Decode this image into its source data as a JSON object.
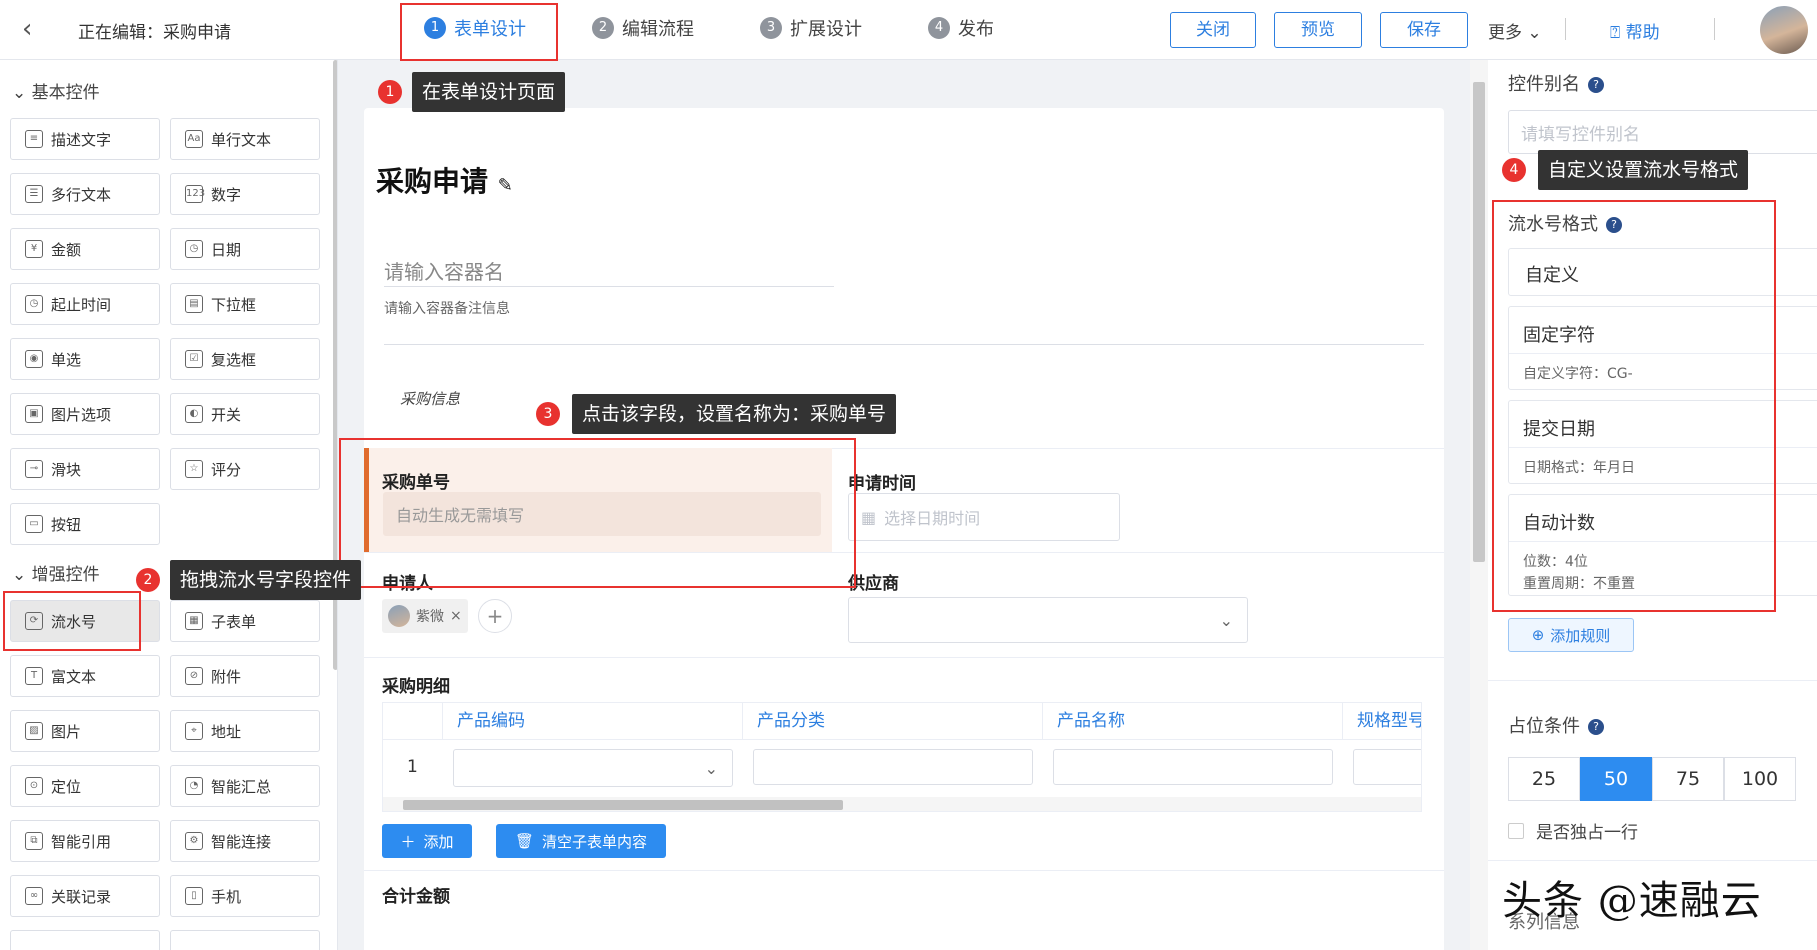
{
  "topbar": {
    "editing_label": "正在编辑：采购申请",
    "steps": [
      {
        "num": "1",
        "label": "表单设计"
      },
      {
        "num": "2",
        "label": "编辑流程"
      },
      {
        "num": "3",
        "label": "扩展设计"
      },
      {
        "num": "4",
        "label": "发布"
      }
    ],
    "close": "关闭",
    "preview": "预览",
    "save": "保存",
    "more": "更多",
    "help": "帮助"
  },
  "sidebar": {
    "basic_title": "基本控件",
    "basic": [
      {
        "label": "描述文字",
        "icon": "≡"
      },
      {
        "label": "单行文本",
        "icon": "Aa"
      },
      {
        "label": "多行文本",
        "icon": "☰"
      },
      {
        "label": "数字",
        "icon": "123"
      },
      {
        "label": "金额",
        "icon": "¥"
      },
      {
        "label": "日期",
        "icon": "◷"
      },
      {
        "label": "起止时间",
        "icon": "◷"
      },
      {
        "label": "下拉框",
        "icon": "▤"
      },
      {
        "label": "单选",
        "icon": "◉"
      },
      {
        "label": "复选框",
        "icon": "☑"
      },
      {
        "label": "图片选项",
        "icon": "▣"
      },
      {
        "label": "开关",
        "icon": "◐"
      },
      {
        "label": "滑块",
        "icon": "⊸"
      },
      {
        "label": "评分",
        "icon": "☆"
      },
      {
        "label": "按钮",
        "icon": "▭"
      }
    ],
    "enhanced_title": "增强控件",
    "enhanced": [
      {
        "label": "流水号",
        "icon": "⟳"
      },
      {
        "label": "子表单",
        "icon": "▦"
      },
      {
        "label": "富文本",
        "icon": "T"
      },
      {
        "label": "附件",
        "icon": "⊘"
      },
      {
        "label": "图片",
        "icon": "▨"
      },
      {
        "label": "地址",
        "icon": "⌖"
      },
      {
        "label": "定位",
        "icon": "⊙"
      },
      {
        "label": "智能汇总",
        "icon": "◔"
      },
      {
        "label": "智能引用",
        "icon": "⧉"
      },
      {
        "label": "智能连接",
        "icon": "⚙"
      },
      {
        "label": "关联记录",
        "icon": "∞"
      },
      {
        "label": "手机",
        "icon": "▯"
      }
    ]
  },
  "canvas": {
    "form_title": "采购申请",
    "container_name_placeholder": "请输入容器名",
    "container_remark_placeholder": "请输入容器备注信息",
    "section_label": "采购信息",
    "field_order_no": "采购单号",
    "field_order_no_placeholder": "自动生成无需填写",
    "field_apply_time": "申请时间",
    "field_apply_time_placeholder": "选择日期时间",
    "field_applicant": "申请人",
    "applicant_tag": "紫微",
    "field_supplier": "供应商",
    "detail_title": "采购明细",
    "table_headers": [
      "产品编码",
      "产品分类",
      "产品名称",
      "规格型号"
    ],
    "row_index": "1",
    "add_btn": "添加",
    "clear_btn": "清空子表单内容",
    "next_section": "合计金额"
  },
  "callouts": {
    "c1": {
      "num": "1",
      "text": "在表单设计页面"
    },
    "c2": {
      "num": "2",
      "text": "拖拽流水号字段控件"
    },
    "c3": {
      "num": "3",
      "text": "点击该字段，设置名称为：采购单号"
    },
    "c4": {
      "num": "4",
      "text": "自定义设置流水号格式"
    }
  },
  "rpanel": {
    "alias_label": "控件别名",
    "alias_placeholder": "请填写控件别名",
    "serial_label": "流水号格式",
    "serial_type": "自定义",
    "rules": [
      {
        "title": "固定字符",
        "sub": "自定义字符：CG-",
        "sub2": ""
      },
      {
        "title": "提交日期",
        "sub": "日期格式：年月日",
        "sub2": ""
      },
      {
        "title": "自动计数",
        "sub": "位数：4位",
        "sub2": "重置周期：不重置"
      }
    ],
    "add_rule": "添加规则",
    "position_label": "占位条件",
    "positions": [
      "25",
      "50",
      "75",
      "100"
    ],
    "position_selected": "50",
    "exclusive_row": "是否独占一行",
    "bottom_label": "系列信息"
  },
  "watermark": "头条 @速融云",
  "colors": {
    "accent": "#2d7fe0",
    "annotation": "#e8322f"
  }
}
